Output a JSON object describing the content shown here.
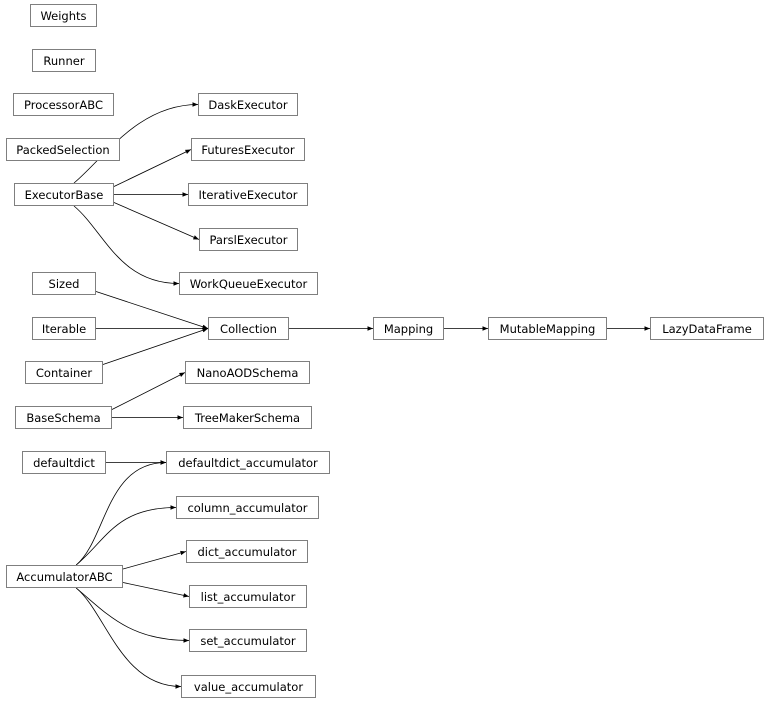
{
  "nodes": [
    {
      "id": "Weights",
      "label": "Weights"
    },
    {
      "id": "Runner",
      "label": "Runner"
    },
    {
      "id": "ProcessorABC",
      "label": "ProcessorABC"
    },
    {
      "id": "PackedSelection",
      "label": "PackedSelection"
    },
    {
      "id": "ExecutorBase",
      "label": "ExecutorBase"
    },
    {
      "id": "DaskExecutor",
      "label": "DaskExecutor"
    },
    {
      "id": "FuturesExecutor",
      "label": "FuturesExecutor"
    },
    {
      "id": "IterativeExecutor",
      "label": "IterativeExecutor"
    },
    {
      "id": "ParslExecutor",
      "label": "ParslExecutor"
    },
    {
      "id": "WorkQueueExecutor",
      "label": "WorkQueueExecutor"
    },
    {
      "id": "Sized",
      "label": "Sized"
    },
    {
      "id": "Iterable",
      "label": "Iterable"
    },
    {
      "id": "Container",
      "label": "Container"
    },
    {
      "id": "Collection",
      "label": "Collection"
    },
    {
      "id": "Mapping",
      "label": "Mapping"
    },
    {
      "id": "MutableMapping",
      "label": "MutableMapping"
    },
    {
      "id": "LazyDataFrame",
      "label": "LazyDataFrame"
    },
    {
      "id": "NanoAODSchema",
      "label": "NanoAODSchema"
    },
    {
      "id": "BaseSchema",
      "label": "BaseSchema"
    },
    {
      "id": "TreeMakerSchema",
      "label": "TreeMakerSchema"
    },
    {
      "id": "defaultdict",
      "label": "defaultdict"
    },
    {
      "id": "defaultdict_accumulator",
      "label": "defaultdict_accumulator"
    },
    {
      "id": "column_accumulator",
      "label": "column_accumulator"
    },
    {
      "id": "dict_accumulator",
      "label": "dict_accumulator"
    },
    {
      "id": "AccumulatorABC",
      "label": "AccumulatorABC"
    },
    {
      "id": "list_accumulator",
      "label": "list_accumulator"
    },
    {
      "id": "set_accumulator",
      "label": "set_accumulator"
    },
    {
      "id": "value_accumulator",
      "label": "value_accumulator"
    }
  ],
  "edges": [
    {
      "from": "ExecutorBase",
      "to": "DaskExecutor"
    },
    {
      "from": "ExecutorBase",
      "to": "FuturesExecutor"
    },
    {
      "from": "ExecutorBase",
      "to": "IterativeExecutor"
    },
    {
      "from": "ExecutorBase",
      "to": "ParslExecutor"
    },
    {
      "from": "ExecutorBase",
      "to": "WorkQueueExecutor"
    },
    {
      "from": "Sized",
      "to": "Collection"
    },
    {
      "from": "Iterable",
      "to": "Collection"
    },
    {
      "from": "Container",
      "to": "Collection"
    },
    {
      "from": "Collection",
      "to": "Mapping"
    },
    {
      "from": "Mapping",
      "to": "MutableMapping"
    },
    {
      "from": "MutableMapping",
      "to": "LazyDataFrame"
    },
    {
      "from": "BaseSchema",
      "to": "NanoAODSchema"
    },
    {
      "from": "BaseSchema",
      "to": "TreeMakerSchema"
    },
    {
      "from": "defaultdict",
      "to": "defaultdict_accumulator"
    },
    {
      "from": "AccumulatorABC",
      "to": "defaultdict_accumulator"
    },
    {
      "from": "AccumulatorABC",
      "to": "column_accumulator"
    },
    {
      "from": "AccumulatorABC",
      "to": "dict_accumulator"
    },
    {
      "from": "AccumulatorABC",
      "to": "list_accumulator"
    },
    {
      "from": "AccumulatorABC",
      "to": "set_accumulator"
    },
    {
      "from": "AccumulatorABC",
      "to": "value_accumulator"
    }
  ]
}
